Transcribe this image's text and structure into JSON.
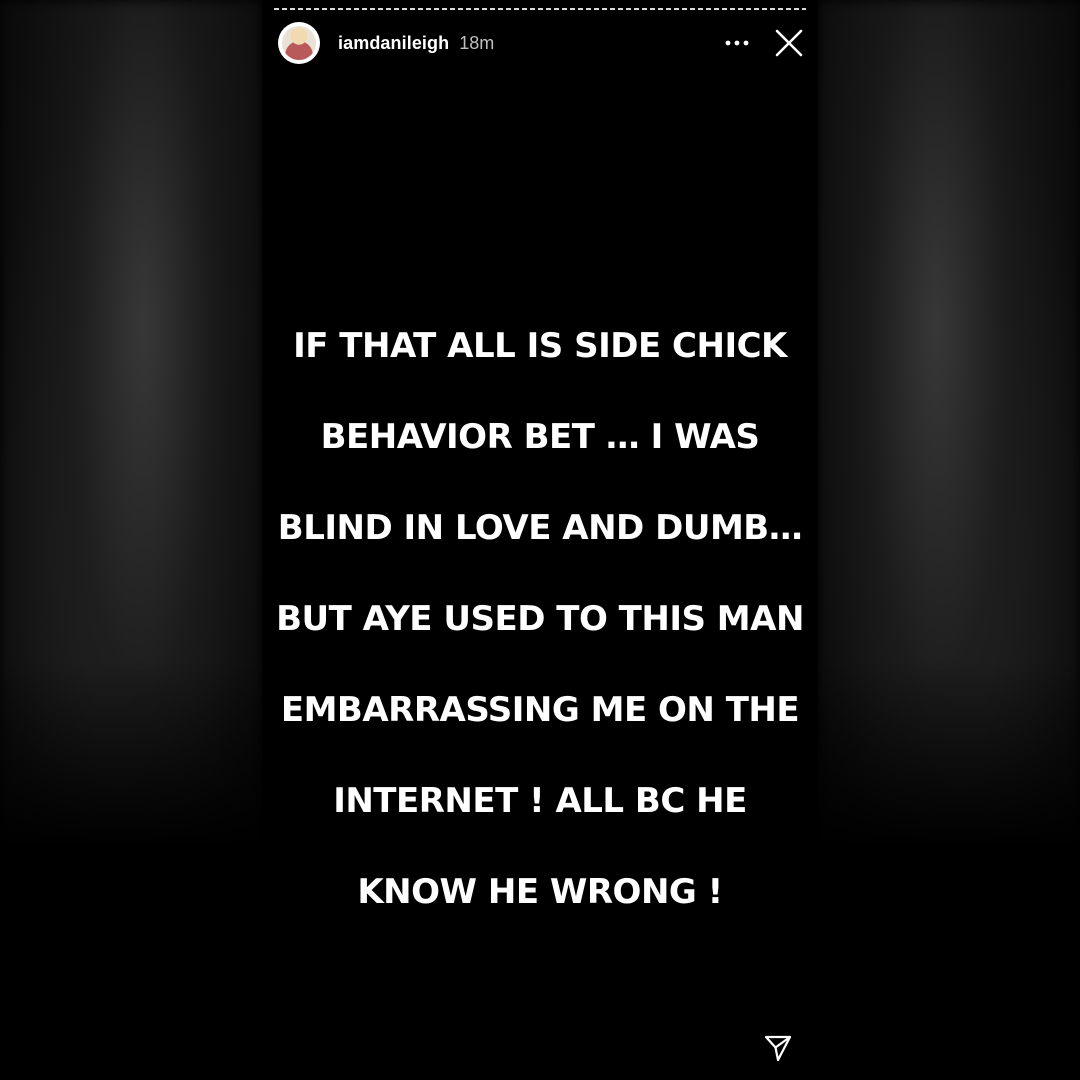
{
  "story": {
    "username": "iamdanileigh",
    "time": "18m",
    "text_lines": [
      "IF THAT ALL IS SIDE CHICK",
      "BEHAVIOR BET …  I WAS",
      "BLIND IN LOVE AND DUMB…",
      "BUT AYE USED TO THIS MAN",
      "EMBARRASSING ME ON THE",
      "INTERNET !  ALL BC HE",
      "KNOW HE WRONG !"
    ]
  },
  "icons": {
    "more": "more-horizontal-icon",
    "close": "close-icon",
    "send": "send-icon"
  },
  "colors": {
    "background": "#000000",
    "text": "#ffffff"
  }
}
